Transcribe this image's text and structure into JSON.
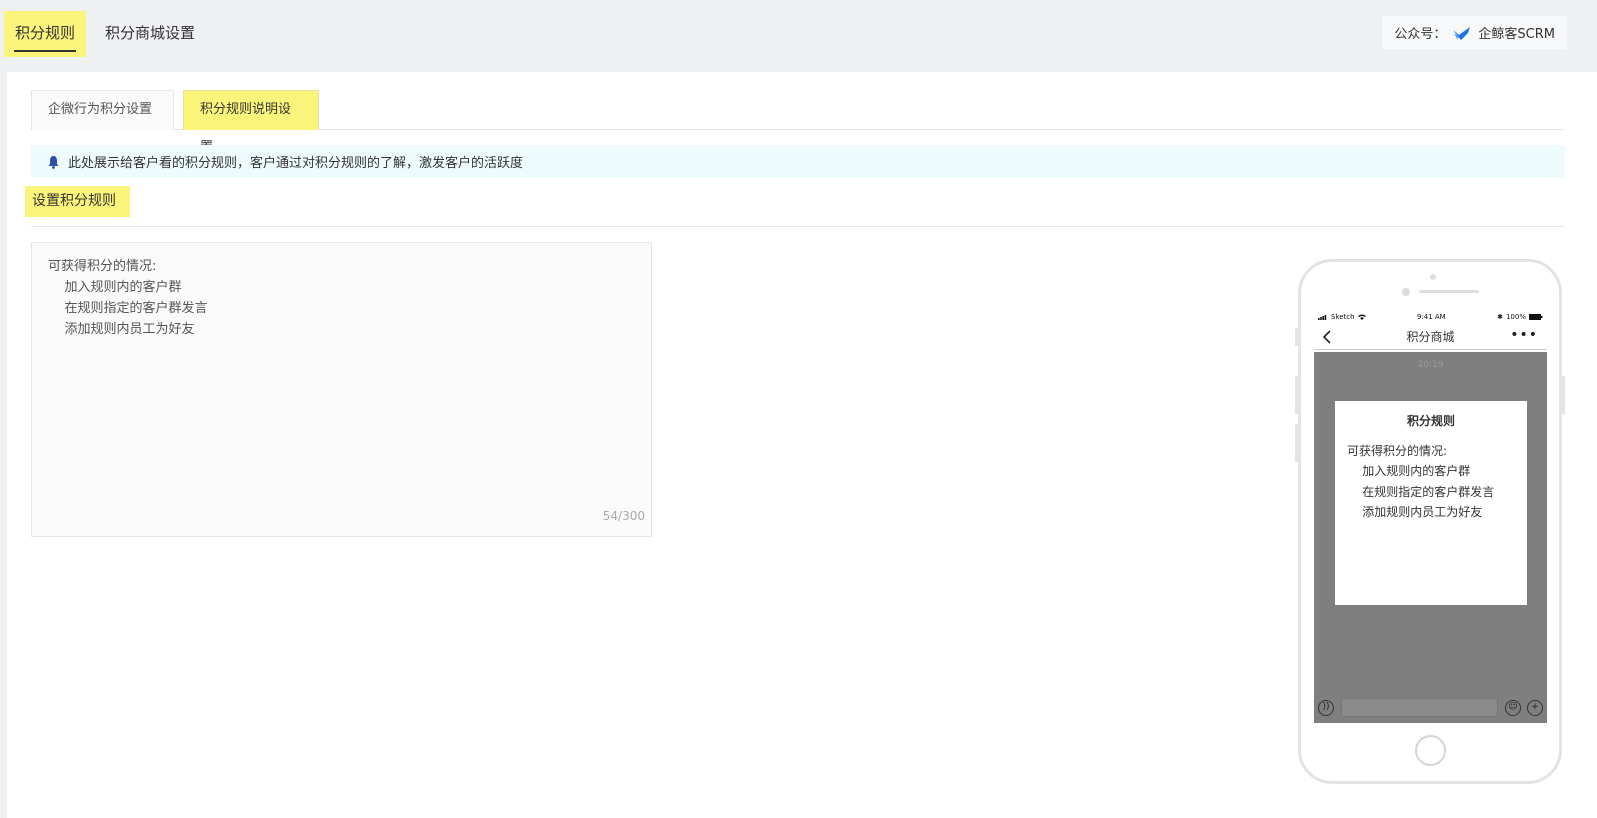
{
  "top_tabs": [
    {
      "label": "积分规则",
      "active": true
    },
    {
      "label": "积分商城设置",
      "active": false
    }
  ],
  "account": {
    "label": "公众号：",
    "name": "企鲸客SCRM",
    "logo_icon": "blue-whale-logo-icon"
  },
  "sub_tabs": [
    {
      "label": "企微行为积分设置",
      "active": false
    },
    {
      "label": "积分规则说明设置",
      "active": true
    }
  ],
  "notice": {
    "icon": "bell-icon",
    "text": "此处展示给客户看的积分规则，客户通过对积分规则的了解，激发客户的活跃度"
  },
  "section_title": "设置积分规则",
  "editor": {
    "lines": [
      "可获得积分的情况:",
      "    加入规则内的客户群",
      "    在规则指定的客户群发言",
      "    添加规则内员工为好友"
    ],
    "counter": "54/300"
  },
  "phone_preview": {
    "status": {
      "carrier": "Sketch",
      "time": "9:41 AM",
      "battery": "100%"
    },
    "nav_title": "积分商城",
    "chat_time": "20:19",
    "card_title": "积分规则",
    "card_lines": [
      "可获得积分的情况:",
      "    加入规则内的客户群",
      "    在规则指定的客户群发言",
      "    添加规则内员工为好友"
    ],
    "colors": {
      "chat_background": "#7f7f7f",
      "highlight": "#fbf47a"
    }
  }
}
